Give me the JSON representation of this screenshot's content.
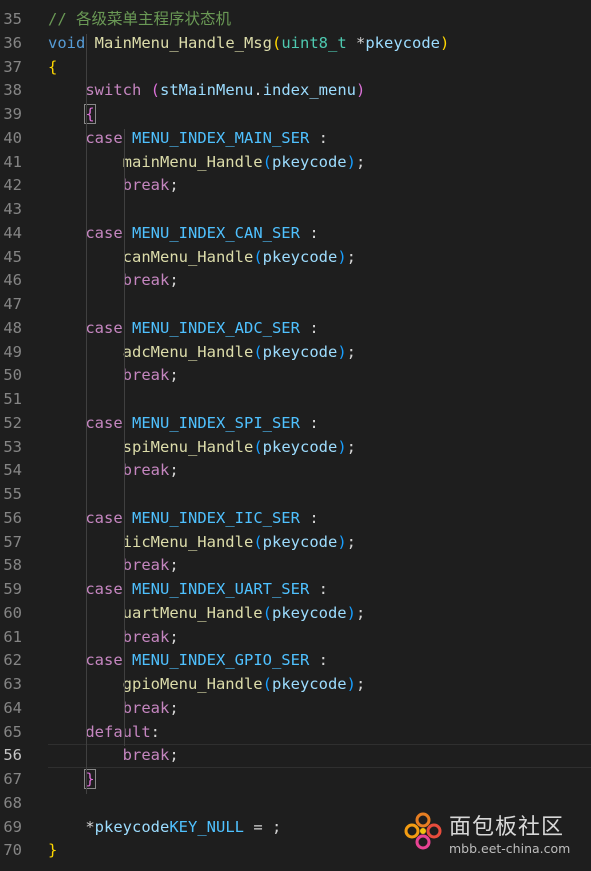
{
  "editor": {
    "active_line": "56",
    "lines": [
      {
        "n": "35",
        "comment": "// 各级菜单主程序状态机"
      },
      {
        "n": "36",
        "kw": "void",
        "fn": "MainMenu_Handle_Msg",
        "p1": "(",
        "type": "uint8_t",
        "star": " *",
        "arg": "pkeycode",
        "p2": ")"
      },
      {
        "n": "37",
        "brace": "{"
      },
      {
        "n": "38",
        "indent": "    ",
        "ctl": "switch",
        "sp": " ",
        "p1": "(",
        "var": "stMainMenu",
        "dot": ".",
        "field": "index_menu",
        "p2": ")"
      },
      {
        "n": "39",
        "indent": "    ",
        "brace": "{"
      },
      {
        "n": "40",
        "indent": "    ",
        "ctl": "case",
        "sp": " ",
        "const": "MENU_INDEX_MAIN_SER",
        "tail": " :"
      },
      {
        "n": "41",
        "indent": "        ",
        "fn": "mainMenu_Handle",
        "p1": "(",
        "arg": "pkeycode",
        "p2": ")",
        "semi": ";"
      },
      {
        "n": "42",
        "indent": "        ",
        "ctl": "break",
        "semi": ";"
      },
      {
        "n": "43"
      },
      {
        "n": "44",
        "indent": "    ",
        "ctl": "case",
        "sp": " ",
        "const": "MENU_INDEX_CAN_SER",
        "tail": " :"
      },
      {
        "n": "45",
        "indent": "        ",
        "fn": "canMenu_Handle",
        "p1": "(",
        "arg": "pkeycode",
        "p2": ")",
        "semi": ";"
      },
      {
        "n": "46",
        "indent": "        ",
        "ctl": "break",
        "semi": ";"
      },
      {
        "n": "47"
      },
      {
        "n": "48",
        "indent": "    ",
        "ctl": "case",
        "sp": " ",
        "const": "MENU_INDEX_ADC_SER",
        "tail": " :"
      },
      {
        "n": "49",
        "indent": "        ",
        "fn": "adcMenu_Handle",
        "p1": "(",
        "arg": "pkeycode",
        "p2": ")",
        "semi": ";"
      },
      {
        "n": "50",
        "indent": "        ",
        "ctl": "break",
        "semi": ";"
      },
      {
        "n": "51"
      },
      {
        "n": "52",
        "indent": "    ",
        "ctl": "case",
        "sp": " ",
        "const": "MENU_INDEX_SPI_SER",
        "tail": " :"
      },
      {
        "n": "53",
        "indent": "        ",
        "fn": "spiMenu_Handle",
        "p1": "(",
        "arg": "pkeycode",
        "p2": ")",
        "semi": ";"
      },
      {
        "n": "54",
        "indent": "        ",
        "ctl": "break",
        "semi": ";"
      },
      {
        "n": "55"
      },
      {
        "n": "56",
        "indent": "    ",
        "ctl": "case",
        "sp": " ",
        "const": "MENU_INDEX_IIC_SER",
        "tail": " :"
      },
      {
        "n": "57",
        "indent": "        ",
        "fn": "iicMenu_Handle",
        "p1": "(",
        "arg": "pkeycode",
        "p2": ")",
        "semi": ";"
      },
      {
        "n": "58",
        "indent": "        ",
        "ctl": "break",
        "semi": ";"
      },
      {
        "n": "59",
        "indent": "    ",
        "ctl": "case",
        "sp": " ",
        "const": "MENU_INDEX_UART_SER",
        "tail": " :"
      },
      {
        "n": "60",
        "indent": "        ",
        "fn": "uartMenu_Handle",
        "p1": "(",
        "arg": "pkeycode",
        "p2": ")",
        "semi": ";"
      },
      {
        "n": "61",
        "indent": "        ",
        "ctl": "break",
        "semi": ";"
      },
      {
        "n": "62",
        "indent": "    ",
        "ctl": "case",
        "sp": " ",
        "const": "MENU_INDEX_GPIO_SER",
        "tail": " :"
      },
      {
        "n": "63",
        "indent": "        ",
        "fn": "gpioMenu_Handle",
        "p1": "(",
        "arg": "pkeycode",
        "p2": ")",
        "semi": ";"
      },
      {
        "n": "64",
        "indent": "        ",
        "ctl": "break",
        "semi": ";"
      },
      {
        "n": "65",
        "indent": "    ",
        "ctl": "default",
        "tail": ":"
      },
      {
        "n": "56",
        "indent": "        ",
        "ctl": "break",
        "semi": ";"
      },
      {
        "n": "67",
        "indent": "    ",
        "brace": "}"
      },
      {
        "n": "68"
      },
      {
        "n": "69",
        "indent": "    ",
        "star": "*",
        "var": "pkeycode",
        "tail": " = ",
        "const": "KEY_NULL",
        "semi": ";"
      },
      {
        "n": "70",
        "brace": "}"
      }
    ]
  },
  "watermark": {
    "title": "面包板社区",
    "url": "mbb.eet-china.com",
    "logo_icon": "mbb-flower-logo-icon"
  }
}
